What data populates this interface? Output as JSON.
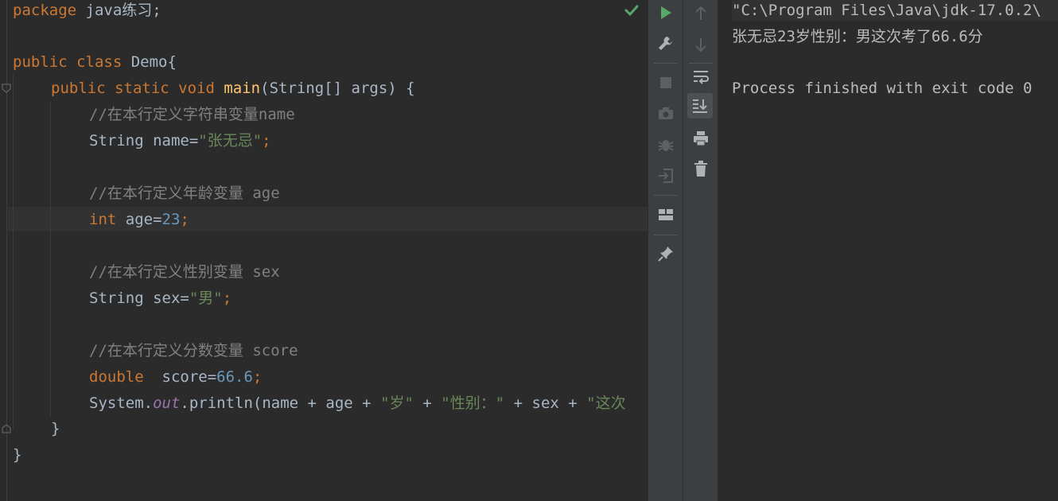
{
  "editor": {
    "package_kw": "package",
    "package_name": " java练习;",
    "class_public": "public",
    "class_kw": " class",
    "class_name": " Demo{",
    "main_public": "public",
    "main_static": " static",
    "main_void": " void",
    "main_name": " main",
    "main_args": "(String[] args) {",
    "comment_name": "//在本行定义字符串变量name",
    "name_decl": "String name=",
    "name_val": "\"张无忌\"",
    "semi": ";",
    "comment_age": "//在本行定义年龄变量 age",
    "age_type": "int",
    "age_decl": " age=",
    "age_val": "23",
    "comment_sex": "//在本行定义性别变量 sex",
    "sex_decl": "String sex=",
    "sex_val": "\"男\"",
    "comment_score": "//在本行定义分数变量 score",
    "score_type": "double",
    "score_decl": "  score=",
    "score_val": "66.6",
    "println_sys": "System.",
    "println_out": "out",
    "println_call": ".println(name + age + ",
    "println_s1": "\"岁\"",
    "println_plus1": " + ",
    "println_s2": "\"性别：\"",
    "println_mid": " + sex + ",
    "println_s3": "\"这次",
    "close_method": "}",
    "close_class": "}"
  },
  "console": {
    "command_line": "\"C:\\Program Files\\Java\\jdk-17.0.2\\",
    "output_line": "张无忌23岁性别：男这次考了66.6分",
    "exit_line": "Process finished with exit code 0"
  },
  "icons": {
    "run": "run-icon",
    "settings": "wrench-icon",
    "stop": "stop-icon",
    "screenshot": "camera-icon",
    "debug": "debug-icon",
    "restore": "restore-layout-icon",
    "layout": "layout-icon",
    "pin": "pin-icon",
    "up": "arrow-up-icon",
    "down": "arrow-down-icon",
    "softwrap": "soft-wrap-icon",
    "scroll_end": "scroll-to-end-icon",
    "print": "print-icon",
    "clear": "trash-icon"
  },
  "colors": {
    "keyword": "#cc7832",
    "function": "#ffc66d",
    "string": "#6a8759",
    "number": "#6897bb",
    "comment": "#808080",
    "field": "#9876aa",
    "run_green": "#59a869"
  }
}
